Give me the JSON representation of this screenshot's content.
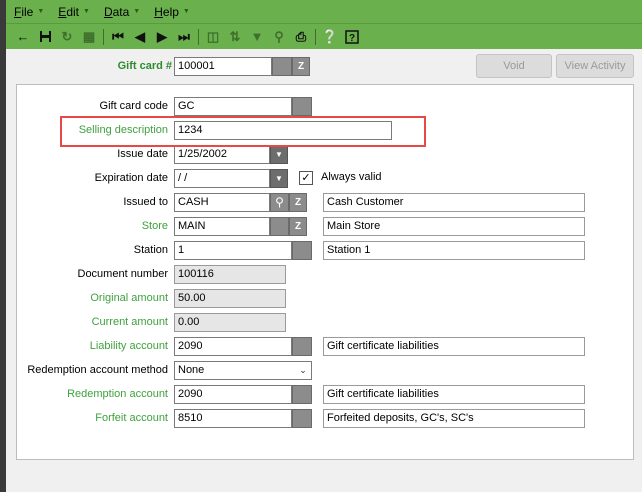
{
  "menu": [
    {
      "key": "F",
      "rest": "ile"
    },
    {
      "key": "E",
      "rest": "dit"
    },
    {
      "key": "D",
      "rest": "ata"
    },
    {
      "key": "H",
      "rest": "elp"
    }
  ],
  "toolbar": {
    "icons": [
      "back-arrow-icon",
      "save-icon",
      "refresh-icon",
      "grid-icon",
      "first-record-icon",
      "previous-record-icon",
      "next-record-icon",
      "last-record-icon",
      "columns-icon",
      "sort-icon",
      "filter-icon",
      "search-icon",
      "print-icon",
      "help-icon",
      "info-icon"
    ]
  },
  "header": {
    "gift_card_label": "Gift card #",
    "gift_card_value": "100001",
    "void_label": "Void",
    "view_activity_label": "View Activity"
  },
  "form": {
    "gift_card_code": {
      "label": "Gift card code",
      "value": "GC"
    },
    "selling_description": {
      "label": "Selling description",
      "value": "1234"
    },
    "issue_date": {
      "label": "Issue date",
      "value": "1/25/2002"
    },
    "expiration_date": {
      "label": "Expiration date",
      "value": " /  /",
      "always_valid_label": "Always valid",
      "always_valid_checked": true
    },
    "issued_to": {
      "label": "Issued to",
      "value": "CASH",
      "description": "Cash Customer"
    },
    "store": {
      "label": "Store",
      "value": "MAIN",
      "description": "Main Store"
    },
    "station": {
      "label": "Station",
      "value": "1",
      "description": "Station 1"
    },
    "document_number": {
      "label": "Document number",
      "value": "100116"
    },
    "original_amount": {
      "label": "Original amount",
      "value": "50.00"
    },
    "current_amount": {
      "label": "Current amount",
      "value": "0.00"
    },
    "liability_account": {
      "label": "Liability account",
      "value": "2090",
      "description": "Gift certificate liabilities"
    },
    "redemption_account_method": {
      "label": "Redemption account method",
      "value": "None"
    },
    "redemption_account": {
      "label": "Redemption account",
      "value": "2090",
      "description": "Gift certificate liabilities"
    },
    "forfeit_account": {
      "label": "Forfeit account",
      "value": "8510",
      "description": "Forfeited deposits, GC's, SC's"
    }
  },
  "colors": {
    "accent": "#6ab04c",
    "green_label": "#3fa13f",
    "highlight": "#e84848"
  }
}
